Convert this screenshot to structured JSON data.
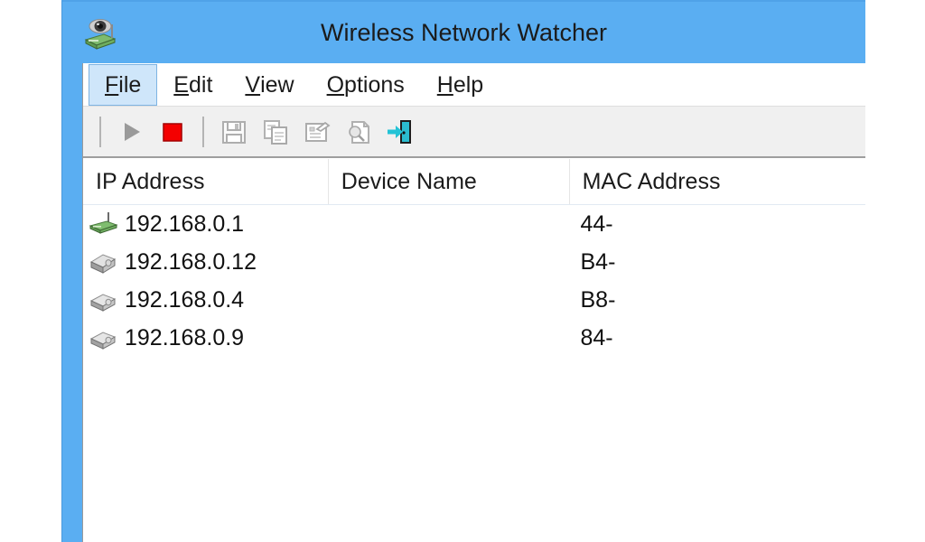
{
  "window": {
    "title": "Wireless Network Watcher",
    "app_icon": "network-watcher-icon",
    "title_bar_color": "#5aaef2",
    "client_background": "#ffffff"
  },
  "menu": {
    "items": [
      {
        "label": "File",
        "accel": "F",
        "rest": "ile",
        "active": true
      },
      {
        "label": "Edit",
        "accel": "E",
        "rest": "dit",
        "active": false
      },
      {
        "label": "View",
        "accel": "V",
        "rest": "iew",
        "active": false
      },
      {
        "label": "Options",
        "accel": "O",
        "rest": "ptions",
        "active": false
      },
      {
        "label": "Help",
        "accel": "H",
        "rest": "elp",
        "active": false
      }
    ]
  },
  "toolbar": {
    "buttons": [
      {
        "name": "start-scan-button",
        "icon": "play-icon",
        "enabled": false,
        "color": "#9a9a9a"
      },
      {
        "name": "stop-scan-button",
        "icon": "stop-icon",
        "enabled": true,
        "color": "#f40000"
      },
      {
        "name": "save-button",
        "icon": "floppy-disk-icon",
        "enabled": false,
        "color": "#b0b0b0"
      },
      {
        "name": "copy-button",
        "icon": "copy-icon",
        "enabled": false,
        "color": "#b0b0b0"
      },
      {
        "name": "properties-button",
        "icon": "properties-icon",
        "enabled": false,
        "color": "#b0b0b0"
      },
      {
        "name": "html-report-button",
        "icon": "report-icon",
        "enabled": false,
        "color": "#b0b0b0"
      },
      {
        "name": "exit-button",
        "icon": "exit-door-icon",
        "enabled": true,
        "color": "#23c3d6"
      }
    ]
  },
  "list": {
    "columns": [
      {
        "key": "ip",
        "label": "IP Address"
      },
      {
        "key": "name",
        "label": "Device Name"
      },
      {
        "key": "mac",
        "label": "MAC Address"
      }
    ],
    "rows": [
      {
        "icon": "wireless-router-icon",
        "ip": "192.168.0.1",
        "name": "",
        "mac": "44-"
      },
      {
        "icon": "network-device-icon",
        "ip": "192.168.0.12",
        "name": "",
        "mac": "B4-"
      },
      {
        "icon": "network-device-icon",
        "ip": "192.168.0.4",
        "name": "",
        "mac": "B8-"
      },
      {
        "icon": "network-device-icon",
        "ip": "192.168.0.9",
        "name": "",
        "mac": "84-"
      }
    ]
  }
}
